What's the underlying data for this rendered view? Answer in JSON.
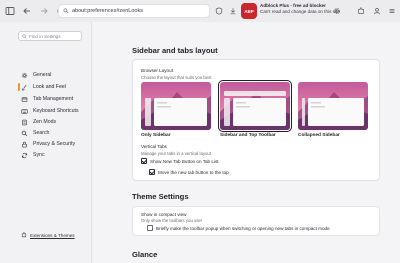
{
  "browser": {
    "url": "about:preferences#zenLooks",
    "extension": {
      "badge": "ABP",
      "title": "Adblock Plus - free ad blocker",
      "subtitle": "Can't read and change data on this site"
    }
  },
  "sidebar": {
    "search_placeholder": "Find in Settings",
    "items": [
      {
        "label": "General",
        "icon": "gear-icon"
      },
      {
        "label": "Look and Feel",
        "icon": "brush-icon",
        "active": true
      },
      {
        "label": "Tab Management",
        "icon": "tabs-icon"
      },
      {
        "label": "Keyboard Shortcuts",
        "icon": "keyboard-icon"
      },
      {
        "label": "Zen Mods",
        "icon": "mods-icon"
      },
      {
        "label": "Search",
        "icon": "search-icon"
      },
      {
        "label": "Privacy & Security",
        "icon": "lock-icon"
      },
      {
        "label": "Sync",
        "icon": "sync-icon"
      }
    ],
    "footer_link": "Extensions & Themes"
  },
  "main": {
    "sidebar_tabs": {
      "heading": "Sidebar and tabs layout",
      "browser_layout_label": "Browser Layout",
      "browser_layout_sub": "Choose the layout that suits you best",
      "layouts": [
        {
          "caption": "Only Sidebar",
          "selected": false
        },
        {
          "caption": "Sidebar and Top Toolbar",
          "selected": true
        },
        {
          "caption": "Collapsed Sidebar",
          "selected": false
        }
      ],
      "vertical_tabs_label": "Vertical Tabs",
      "vertical_tabs_sub": "Manage your tabs in a vertical layout",
      "show_new_tab_label": "Show New Tab Button on Tab List",
      "show_new_tab_checked": true,
      "move_new_tab_label": "Move the new tab button to the top",
      "move_new_tab_checked": true
    },
    "theme": {
      "heading": "Theme Settings",
      "compact_label": "Show in compact view",
      "compact_sub": "Only show the toolbars you use!",
      "popup_label": "Briefly make the toolbar popup when switching or opening new tabs in compact mode",
      "popup_checked": false
    },
    "glance": {
      "heading": "Glance"
    }
  },
  "colors": {
    "accent": "#e89a2d",
    "abp_red": "#c8272d"
  }
}
